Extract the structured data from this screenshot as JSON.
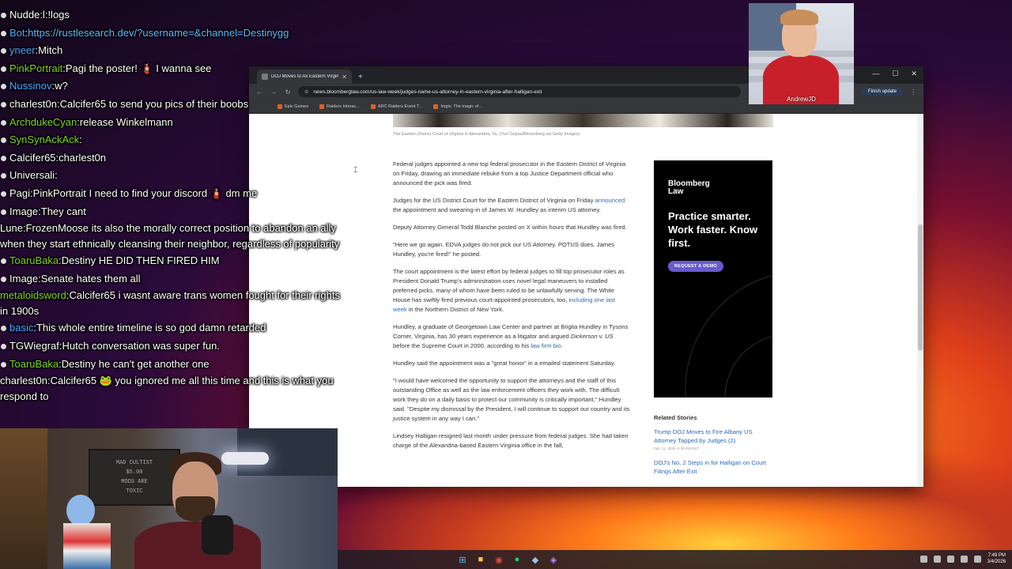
{
  "chat": [
    {
      "user": "Nudde",
      "user_color": "white",
      "text": "l:!logs",
      "prefix": "Ǌ"
    },
    {
      "user": "Bot",
      "user_color": "blue",
      "text": "https://rustlesearch.dev/?username=&channel=Destinygg",
      "is_link": true
    },
    {
      "user": "yneer",
      "user_color": "blue",
      "text": "Mitch"
    },
    {
      "user": "PinkPortrait",
      "user_color": "green",
      "text": "Pagi the poster! 🧯 I wanna see"
    },
    {
      "user": "Nussinov",
      "user_color": "blue",
      "text": "w?"
    },
    {
      "user": "charlest0n",
      "user_color": "white",
      "text": "Calcifer65 to send you pics of their boobs"
    },
    {
      "user": "ArchdukeCyan",
      "user_color": "green",
      "text": "release Winkelmann"
    },
    {
      "user": "SynSynAckAck",
      "user_color": "green",
      "text": ""
    },
    {
      "user": "Calcifer65",
      "user_color": "white",
      "text": "charlest0n"
    },
    {
      "user": "Universali",
      "user_color": "white",
      "text": ""
    },
    {
      "user": "Pagi",
      "user_color": "white",
      "text": "PinkPortrait I need to find your discord 🧯 dm me"
    },
    {
      "user": "Image",
      "user_color": "white",
      "text": "They cant"
    },
    {
      "user": "Lune",
      "user_color": "white",
      "text": "FrozenMoose its also the morally correct position to abandon an ally when they start ethnically cleansing their neighbor, regardless of popularity",
      "wrap": true
    },
    {
      "user": "ToaruBaka",
      "user_color": "green",
      "text": "Destiny HE DID THEN FIRED HIM"
    },
    {
      "user": "Image",
      "user_color": "white",
      "text": "Senate hates them all"
    },
    {
      "user": "metaloidsword",
      "user_color": "green",
      "text": "Calcifer65 i wasnt aware trans women fought for their rights in 1900s",
      "wrap": true
    },
    {
      "user": "basic",
      "user_color": "blue",
      "text": "This whole entire timeline is so god damn retarded"
    },
    {
      "user": "TGWiegraf",
      "user_color": "white",
      "text": "Hutch conversation was super fun."
    },
    {
      "user": "ToaruBaka",
      "user_color": "green",
      "text": "Destiny he can't get another one"
    },
    {
      "user": "charlest0n",
      "user_color": "white",
      "text": "Calcifer65 🐸 you ignored me all this time and this is what you respond to",
      "wrap": true
    }
  ],
  "browser": {
    "tab_title": "DOJ Moves to Ax Eastern Virginia",
    "url": "news.bloomberglaw.com/us-law-week/judges-name-us-attorney-in-eastern-virginia-after-halligan-exit",
    "finish_update": "Finish update",
    "bookmarks": [
      "Epic Games",
      "Raiders Interac...",
      "ARC Raiders Event T...",
      "Imgix: The magic of..."
    ]
  },
  "article": {
    "caption": "The Eastern District Court of Virginia in Alexandria, Va. (Yuri Gripas/Bloomberg via Getty Images)",
    "p1": "Federal judges appointed a new top federal prosecutor in the Eastern District of Virginia on Friday, drawing an immediate rebuke from a top Justice Department official who announced the pick was fired.",
    "p2_pre": "Judges for the US District Court for the Eastern District of Virginia on Friday ",
    "p2_link": "announced",
    "p2_post": " the appointment and swearing-in of James W. Hundley as interim US attorney.",
    "p3": "Deputy Attorney General Todd Blanche posted on X within hours that Hundley was fired.",
    "p4": "\"Here we go again. EDVA judges do not pick our US Attorney. POTUS does. James Hundley, you're fired!\" he posted.",
    "p5_pre": "The court appointment is the latest effort by federal judges to fill top prosecutor roles as President Donald Trump's administration uses novel legal maneuvers to installed preferred picks, many of whom have been ruled to be unlawfully serving. The White House has swiftly fired previous court-appointed prosecutors, too, ",
    "p5_link": "including one last week",
    "p5_post": " in the Northern District of New York.",
    "p6_pre": "Hundley, a graduate of Georgetown Law Center and partner at Briglia Hundley in Tysons Corner, Virginia, has 30 years experience as a litigator and argued ",
    "p6_italic": "Dickerson v. US",
    "p6_mid": " before the Supreme Court in 2000, according to his ",
    "p6_link": "law firm bio",
    "p6_post": ".",
    "p7": "Hundley said the appointment was a \"great honor\" in a emailed statement Saturday.",
    "p8": "\"I would have welcomed the opportunity to support the attorneys and the staff of this outstanding Office as well as the law enforcement officers they work with. The difficult work they do on a daily basis to protect our community is critically important,\" Hundley said. \"Despite my dismissal by the President, I will continue to support our country and its justice system in any way I can.\"",
    "p9": "Lindsey Halligan resigned last month under pressure from federal judges. She had taken charge of the Alexandria-based Eastern Virginia office in the fall,"
  },
  "ad": {
    "brand_line1": "Bloomberg",
    "brand_line2": "Law",
    "headline": "Practice smarter. Work faster. Know first.",
    "button": "REQUEST A DEMO"
  },
  "related": {
    "heading": "Related Stories",
    "items": [
      {
        "title": "Trump DOJ Moves to Fire Albany US Attorney Tapped by Judges (2)",
        "date": "Feb. 11, 2026, 5:36 PM EST"
      },
      {
        "title": "DOJ's No. 2 Steps in for Halligan on Court Filings After Exit",
        "date": ""
      }
    ]
  },
  "webcam_top": {
    "name": "AndrewJD"
  },
  "webcam_bottom": {
    "board_text": "MAD CULTIST\n$5.00\nMODS ARE\nTOXIC"
  },
  "taskbar": {
    "time": "7:49 PM",
    "date": "3/4/2026"
  },
  "colors": {
    "link": "#2a6bb8",
    "ad_button": "#6a5acd",
    "chat_green": "#7ed321",
    "chat_blue": "#4aa8ff"
  }
}
